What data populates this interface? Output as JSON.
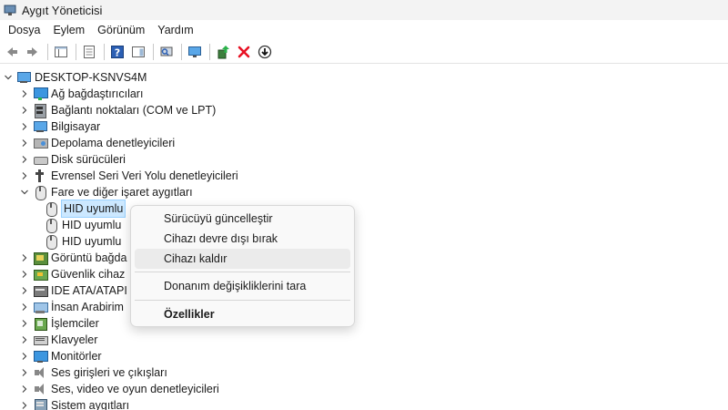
{
  "window": {
    "title": "Aygıt Yöneticisi"
  },
  "menu": [
    "Dosya",
    "Eylem",
    "Görünüm",
    "Yardım"
  ],
  "tree": {
    "root": "DESKTOP-KSNVS4M",
    "categories": [
      {
        "label": "Ağ bağdaştırıcıları",
        "icon": "network-adapter-icon"
      },
      {
        "label": "Bağlantı noktaları (COM ve LPT)",
        "icon": "port-icon"
      },
      {
        "label": "Bilgisayar",
        "icon": "computer-icon"
      },
      {
        "label": "Depolama denetleyicileri",
        "icon": "storage-icon"
      },
      {
        "label": "Disk sürücüleri",
        "icon": "disk-icon"
      },
      {
        "label": "Evrensel Seri Veri Yolu denetleyicileri",
        "icon": "usb-icon"
      },
      {
        "label": "Fare ve diğer işaret aygıtları",
        "icon": "mouse-icon",
        "expanded": true
      },
      {
        "label": "Görüntü bağda",
        "icon": "display-adapter-icon"
      },
      {
        "label": "Güvenlik cihaz",
        "icon": "security-device-icon"
      },
      {
        "label": "IDE ATA/ATAPI d",
        "icon": "ide-controller-icon"
      },
      {
        "label": "İnsan Arabirim",
        "icon": "hid-icon"
      },
      {
        "label": "İşlemciler",
        "icon": "processor-icon"
      },
      {
        "label": "Klavyeler",
        "icon": "keyboard-icon"
      },
      {
        "label": "Monitörler",
        "icon": "monitor-icon"
      },
      {
        "label": "Ses girişleri ve çıkışları",
        "icon": "audio-io-icon"
      },
      {
        "label": "Ses, video ve oyun denetleyicileri",
        "icon": "audio-controller-icon"
      },
      {
        "label": "Sistem aygıtları",
        "icon": "system-device-icon"
      }
    ],
    "mouse_children": [
      "HID uyumlu",
      "HID uyumlu",
      "HID uyumlu"
    ]
  },
  "context_menu": {
    "update_driver": "Sürücüyü güncelleştir",
    "disable_device": "Cihazı devre dışı bırak",
    "uninstall_device": "Cihazı kaldır",
    "scan_changes": "Donanım değişikliklerini tara",
    "properties": "Özellikler"
  },
  "colors": {
    "selection": "#cce8ff",
    "menu_hover": "#ebebeb",
    "delete_red": "#e81123"
  }
}
